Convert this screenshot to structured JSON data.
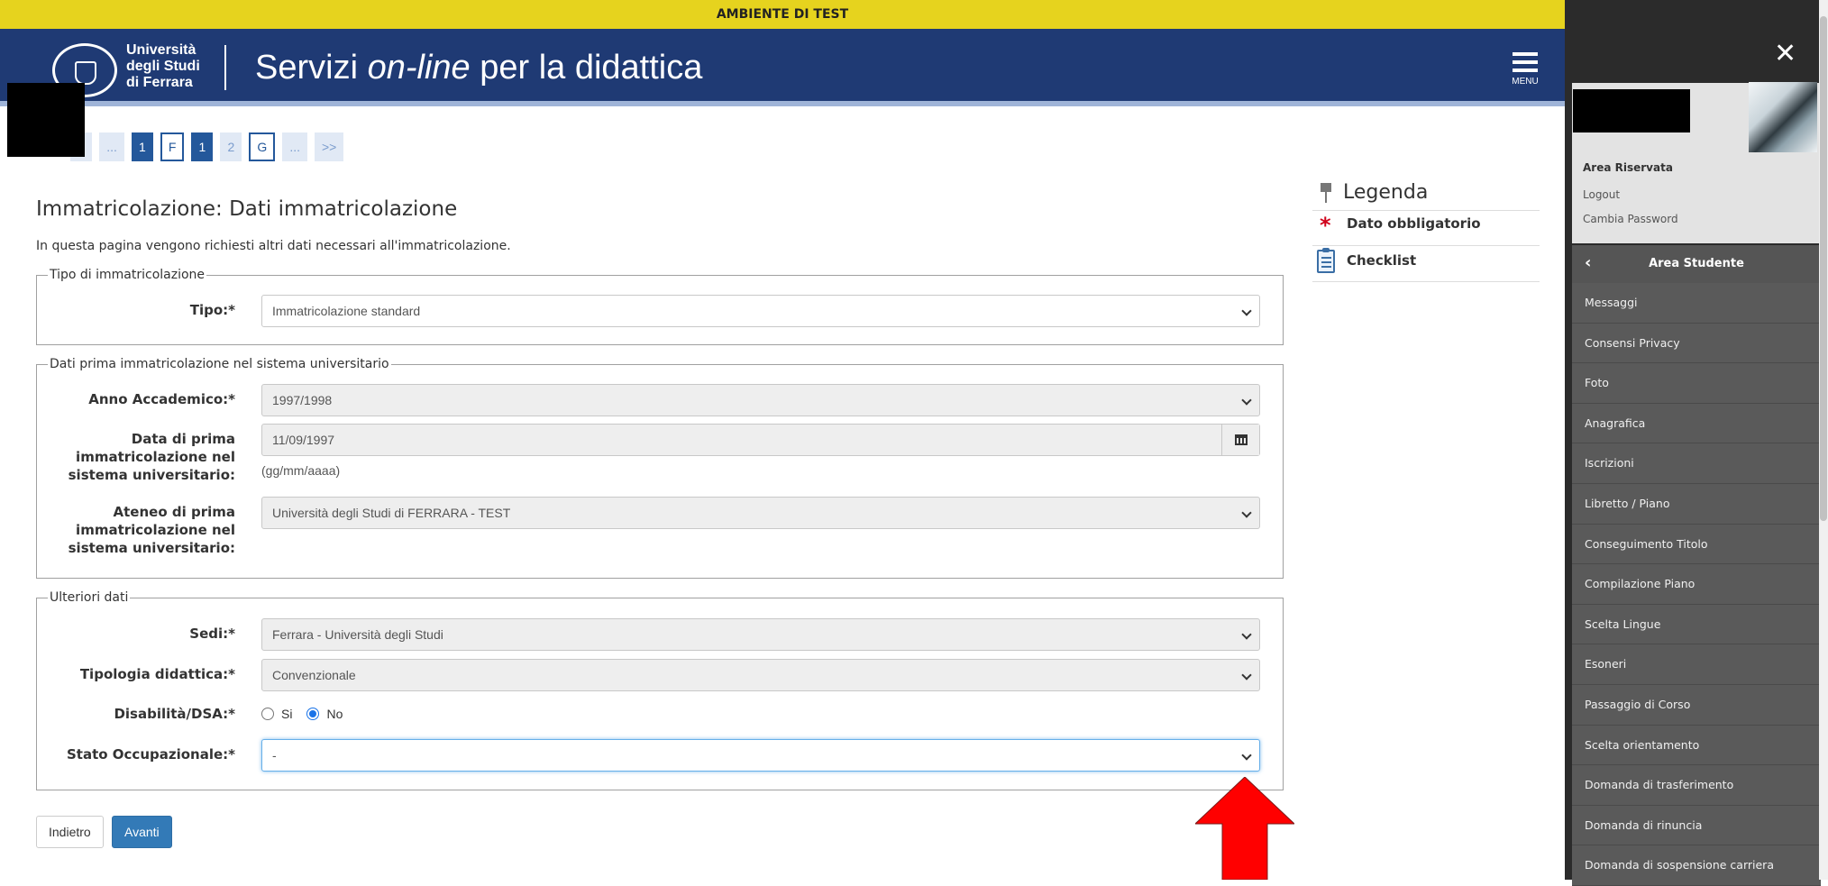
{
  "banner": {
    "text": "AMBIENTE DI TEST"
  },
  "header": {
    "logo_lines": [
      "Università",
      "degli Studi",
      "di Ferrara"
    ],
    "title_prefix": "Servizi ",
    "title_italic": "on-line",
    "title_suffix": " per la didattica",
    "menu_label": "MENU"
  },
  "pager": [
    {
      "label": "<",
      "style": "light"
    },
    {
      "label": "...",
      "style": "light"
    },
    {
      "label": "1",
      "style": "dark"
    },
    {
      "label": "F",
      "style": "outline"
    },
    {
      "label": "1",
      "style": "dark"
    },
    {
      "label": "2",
      "style": "light"
    },
    {
      "label": "G",
      "style": "outline"
    },
    {
      "label": "...",
      "style": "light"
    },
    {
      "label": ">>",
      "style": "light"
    }
  ],
  "page": {
    "title": "Immatricolazione: Dati immatricolazione",
    "intro": "In questa pagina vengono richiesti altri dati necessari all'immatricolazione."
  },
  "tipo_section": {
    "legend": "Tipo di immatricolazione",
    "tipo_label": "Tipo:*",
    "tipo_value": "Immatricolazione standard"
  },
  "prima_section": {
    "legend": "Dati prima immatricolazione nel sistema universitario",
    "anno_label": "Anno Accademico:*",
    "anno_value": "1997/1998",
    "data_label_1": "Data di prima",
    "data_label_2": "immatricolazione nel",
    "data_label_3": "sistema universitario:",
    "data_value": "11/09/1997",
    "data_hint": "(gg/mm/aaaa)",
    "ateneo_label_1": "Ateneo di prima",
    "ateneo_label_2": "immatricolazione nel",
    "ateneo_label_3": "sistema universitario:",
    "ateneo_value": "Università degli Studi di FERRARA - TEST"
  },
  "ulteriori_section": {
    "legend": "Ulteriori dati",
    "sedi_label": "Sedi:*",
    "sedi_value": "Ferrara - Università degli Studi",
    "tipologia_label": "Tipologia didattica:*",
    "tipologia_value": "Convenzionale",
    "disabilita_label": "Disabilità/DSA:*",
    "radio_si": "Si",
    "radio_no": "No",
    "disabilita_selected": "No",
    "stato_label": "Stato Occupazionale:*",
    "stato_value": "-"
  },
  "buttons": {
    "back": "Indietro",
    "next": "Avanti"
  },
  "legenda": {
    "title": "Legenda",
    "required": "Dato obbligatorio",
    "checklist": "Checklist"
  },
  "side_panel": {
    "area_riservata": "Area Riservata",
    "logout": "Logout",
    "change_password": "Cambia Password",
    "area_title": "Area Studente",
    "items": [
      "Messaggi",
      "Consensi Privacy",
      "Foto",
      "Anagrafica",
      "Iscrizioni",
      "Libretto / Piano",
      "Conseguimento Titolo",
      "Compilazione Piano",
      "Scelta Lingue",
      "Esoneri",
      "Passaggio di Corso",
      "Scelta orientamento",
      "Domanda di trasferimento",
      "Domanda di rinuncia",
      "Domanda di sospensione carriera"
    ]
  },
  "colors": {
    "header": "#1f3a74",
    "banner": "#e6d31e",
    "primary_button": "#337ab7",
    "arrow": "#ff0000"
  }
}
